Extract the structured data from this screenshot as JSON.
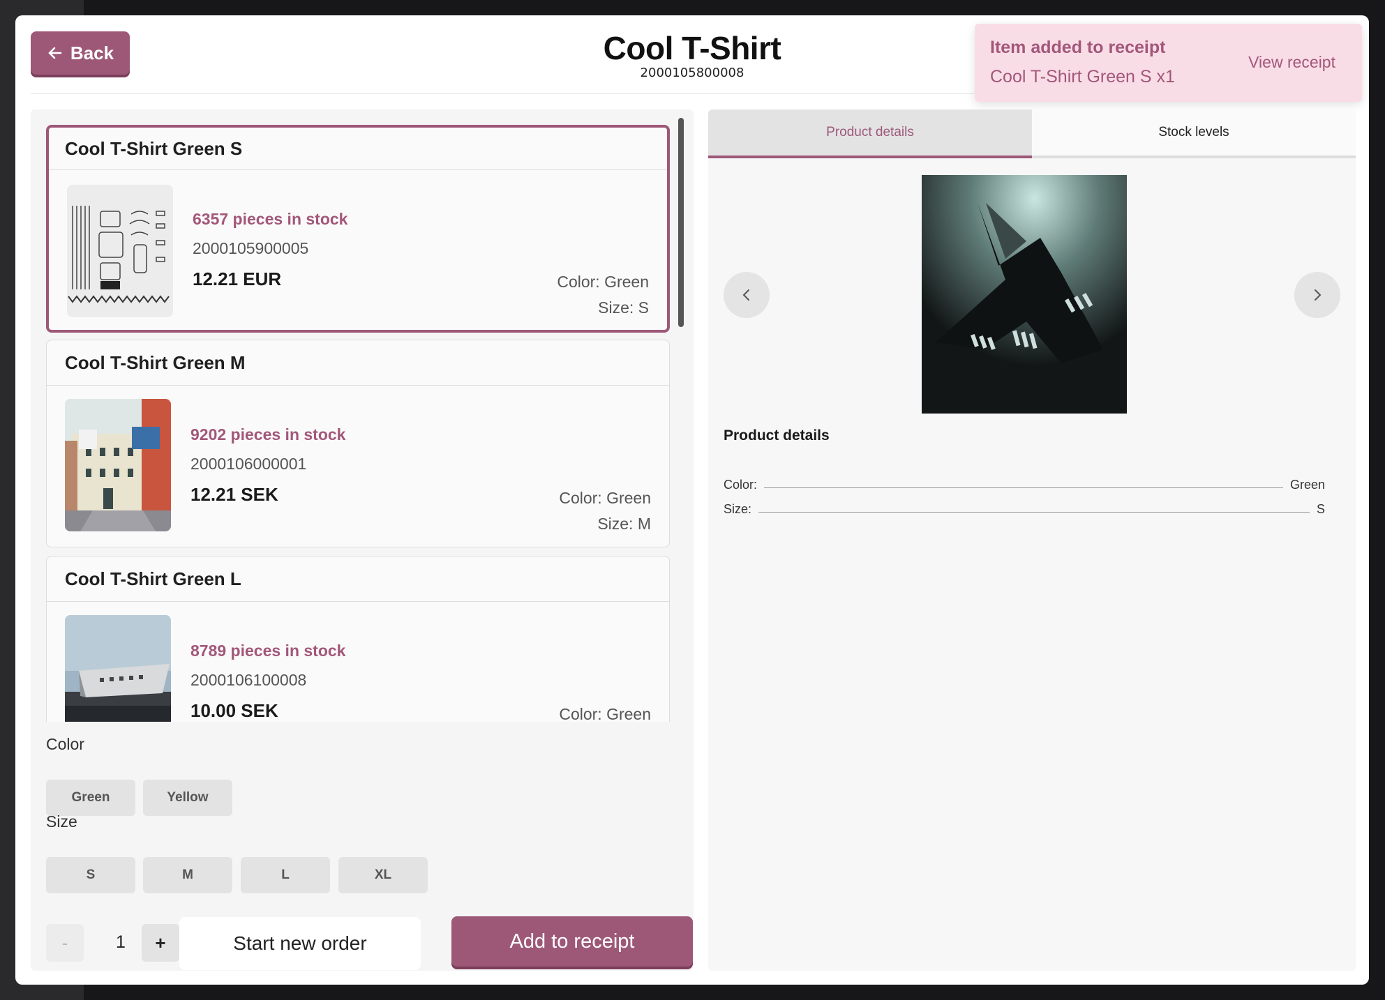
{
  "header": {
    "back_label": "Back",
    "title": "Cool T-Shirt",
    "sku": "2000105800008"
  },
  "toast": {
    "title": "Item added to receipt",
    "message": "Cool T-Shirt Green S x1",
    "link": "View receipt"
  },
  "variants": [
    {
      "name": "Cool T-Shirt Green S",
      "stock": "6357 pieces in stock",
      "sku": "2000105900005",
      "price": "12.21 EUR",
      "color": "Color: Green",
      "size": "Size: S",
      "selected": true
    },
    {
      "name": "Cool T-Shirt Green M",
      "stock": "9202 pieces in stock",
      "sku": "2000106000001",
      "price": "12.21 SEK",
      "color": "Color: Green",
      "size": "Size: M",
      "selected": false
    },
    {
      "name": "Cool T-Shirt Green L",
      "stock": "8789 pieces in stock",
      "sku": "2000106100008",
      "price": "10.00 SEK",
      "color": "Color: Green",
      "selected": false
    }
  ],
  "options": {
    "color_label": "Color",
    "colors": [
      "Green",
      "Yellow"
    ],
    "size_label": "Size",
    "sizes": [
      "S",
      "M",
      "L",
      "XL"
    ]
  },
  "footer": {
    "minus": "-",
    "quantity": "1",
    "plus": "+",
    "new_order": "Start new order",
    "add": "Add to receipt"
  },
  "tabs": {
    "details": "Product details",
    "stock": "Stock levels"
  },
  "details": {
    "title": "Product details",
    "rows": [
      {
        "label": "Color:",
        "value": "Green"
      },
      {
        "label": "Size:",
        "value": "S"
      }
    ]
  },
  "icons": {
    "back": "arrow-left-icon",
    "prev": "chevron-left-icon",
    "next": "chevron-right-icon"
  },
  "colors": {
    "accent": "#9d5878",
    "toast_bg": "#f9dde6",
    "chip_bg": "#e3e3e3"
  }
}
